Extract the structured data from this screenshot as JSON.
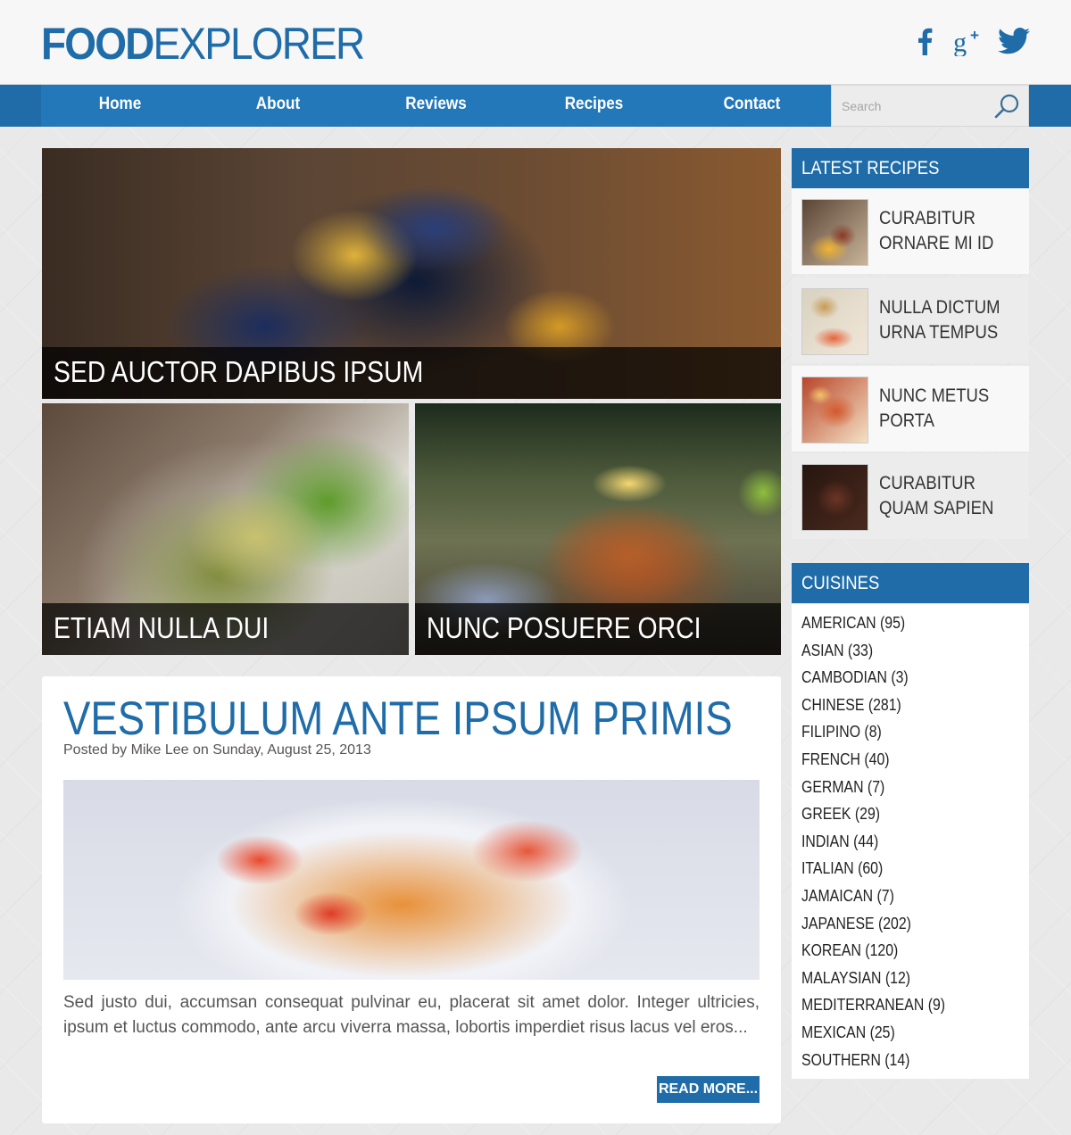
{
  "brand": {
    "logo_bold": "FOOD",
    "logo_light": "EXPLORER",
    "color": "#1f6ca8"
  },
  "social": [
    {
      "icon": "facebook-icon"
    },
    {
      "icon": "google-plus-icon"
    },
    {
      "icon": "twitter-icon"
    }
  ],
  "nav": {
    "items": [
      "Home",
      "About",
      "Reviews",
      "Recipes",
      "Contact"
    ]
  },
  "search": {
    "placeholder": "Search",
    "icon": "search-icon"
  },
  "featured": [
    {
      "caption": "SED AUCTOR DAPIBUS IPSUM"
    },
    {
      "caption": "ETIAM NULLA DUI"
    },
    {
      "caption": "NUNC POSUERE ORCI"
    }
  ],
  "article": {
    "title": "VESTIBULUM ANTE IPSUM PRIMIS",
    "meta": "Posted by Mike Lee on Sunday, August 25, 2013",
    "excerpt": "Sed justo dui, accumsan consequat pulvinar eu, placerat sit amet dolor. Integer ultricies, ipsum et luctus commodo, ante arcu viverra massa, lobortis imperdiet risus lacus vel eros...",
    "read_more": "READ MORE..."
  },
  "sidebar": {
    "latest_title": "LATEST RECIPES",
    "latest": [
      {
        "line1": "CURABITUR",
        "line2": "ORNARE MI ID"
      },
      {
        "line1": "NULLA DICTUM",
        "line2": "URNA TEMPUS"
      },
      {
        "line1": "NUNC METUS",
        "line2": "PORTA"
      },
      {
        "line1": "CURABITUR",
        "line2": "QUAM SAPIEN"
      }
    ],
    "cuisines_title": "CUISINES",
    "cuisines": [
      "AMERICAN (95)",
      "ASIAN (33)",
      "CAMBODIAN (3)",
      "CHINESE (281)",
      "FILIPINO (8)",
      "FRENCH (40)",
      "GERMAN (7)",
      "GREEK (29)",
      "INDIAN (44)",
      "ITALIAN (60)",
      "JAMAICAN (7)",
      "JAPANESE (202)",
      "KOREAN (120)",
      "MALAYSIAN (12)",
      "MEDITERRANEAN (9)",
      "MEXICAN (25)",
      "SOUTHERN (14)"
    ]
  }
}
